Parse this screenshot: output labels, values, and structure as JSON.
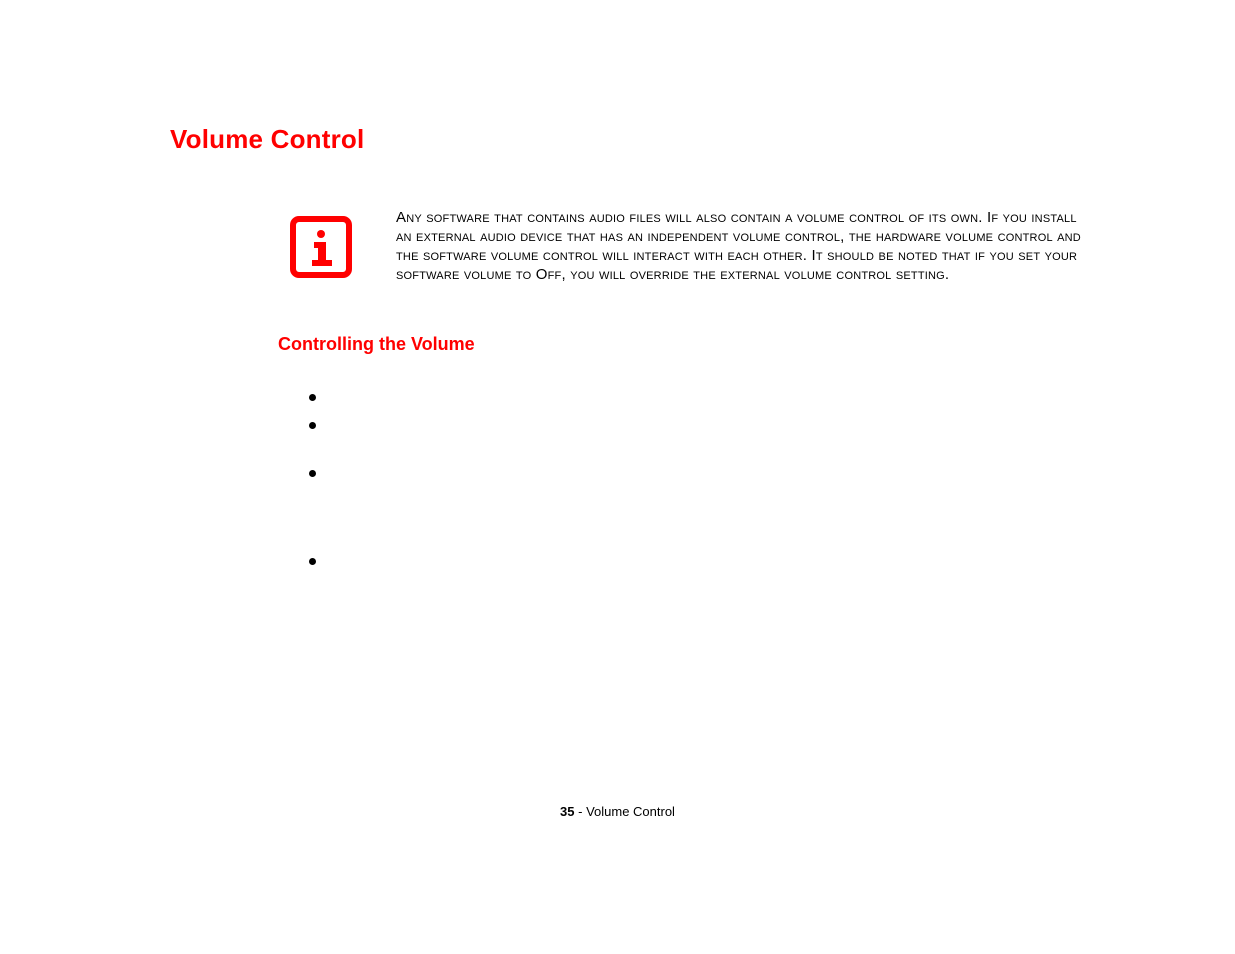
{
  "title": "Volume Control",
  "info_icon": "info-icon",
  "info_text": "Any software that contains audio files will also contain a volume control of its own. If you install an external audio device that has an independent volume control, the hardware volume control and the software volume control will interact with each other. It should be noted that if you set your software volume to Off, you will override the external volume control setting.",
  "subheading": "Controlling the Volume",
  "bullets_y_offsets": [
    0,
    28,
    76,
    164
  ],
  "footer": {
    "page_number": "35",
    "separator": " - ",
    "section": "Volume Control"
  }
}
